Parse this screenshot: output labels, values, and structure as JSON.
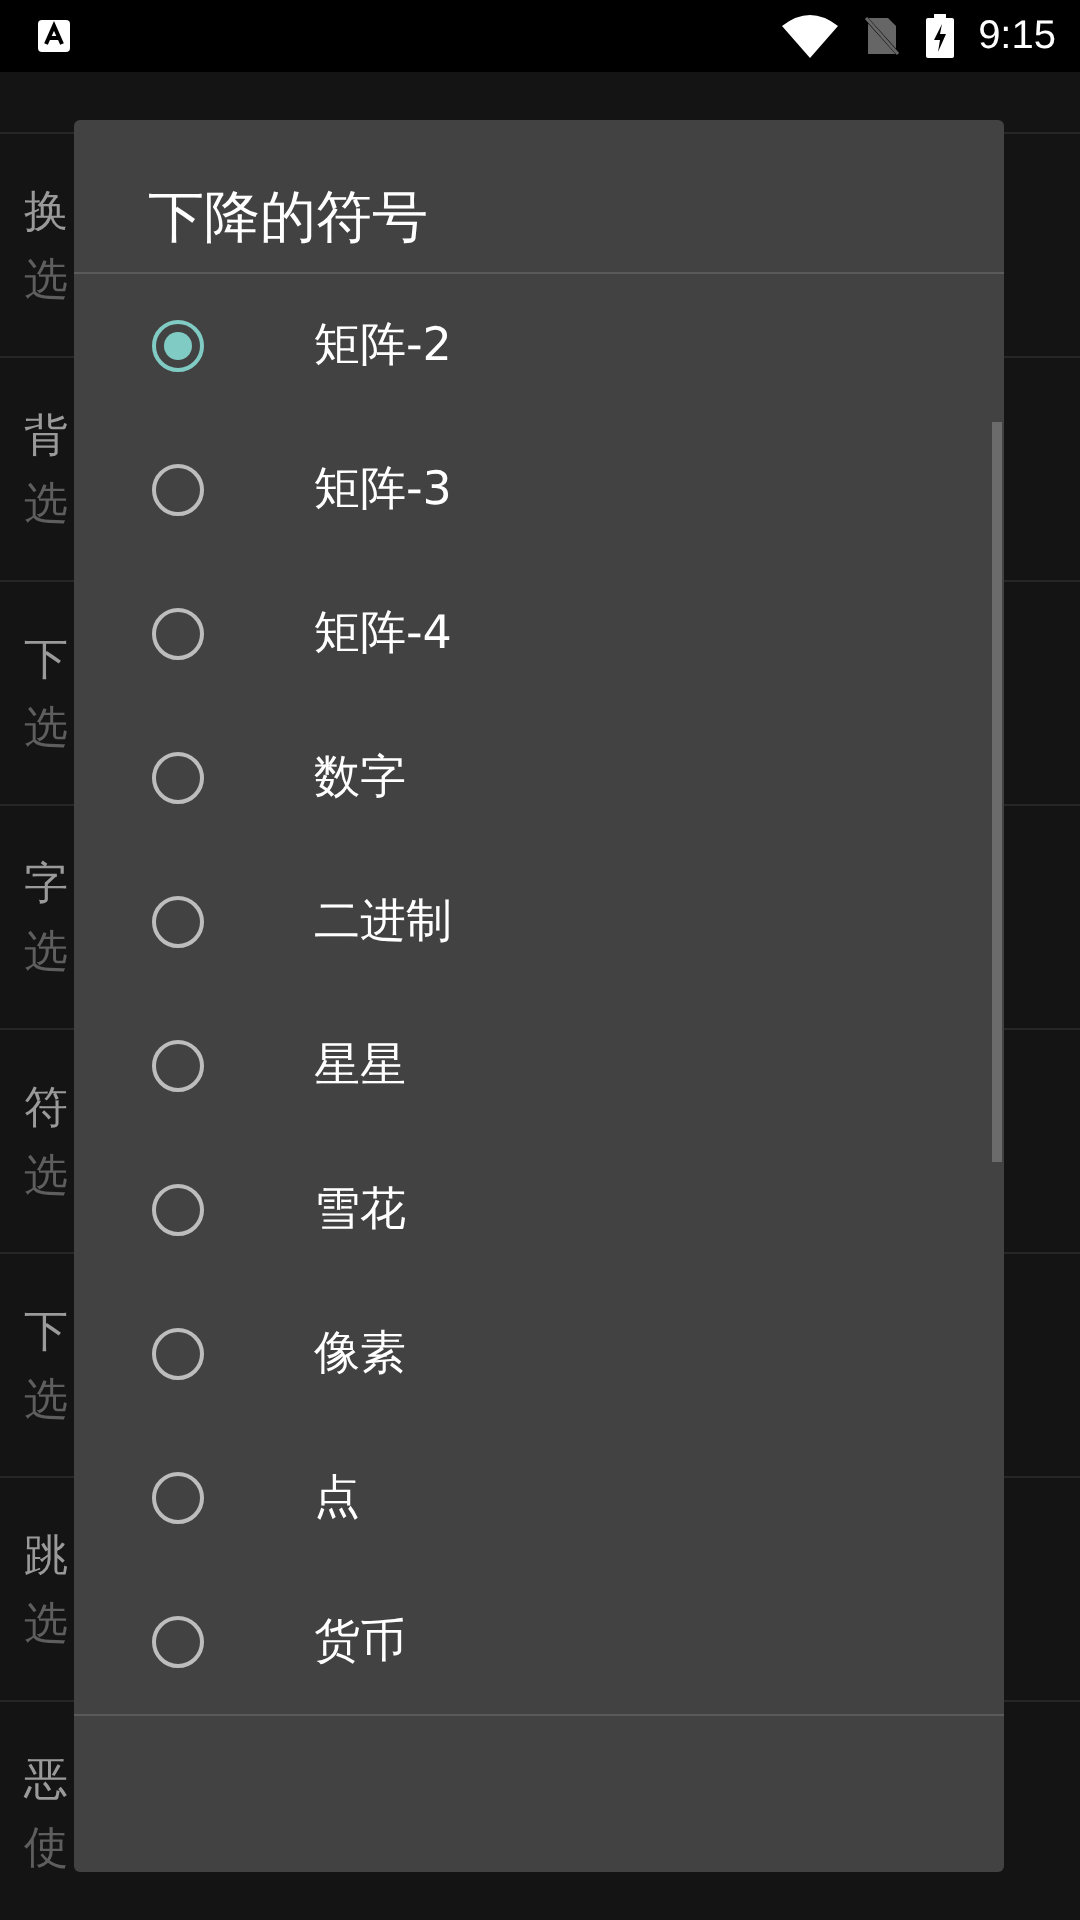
{
  "status_bar": {
    "time": "9:15"
  },
  "background_rows": [
    {
      "title": "换",
      "subtitle": "选"
    },
    {
      "title": "背",
      "subtitle": "选"
    },
    {
      "title": "下",
      "subtitle": "选"
    },
    {
      "title": "字",
      "subtitle": "选"
    },
    {
      "title": "符",
      "subtitle": "选"
    },
    {
      "title": "下",
      "subtitle": "选"
    },
    {
      "title": "跳",
      "subtitle": "选"
    },
    {
      "title": "恶",
      "subtitle": "使"
    }
  ],
  "dialog": {
    "title": "下降的符号",
    "options": [
      {
        "label": "矩阵-2",
        "selected": true
      },
      {
        "label": "矩阵-3",
        "selected": false
      },
      {
        "label": "矩阵-4",
        "selected": false
      },
      {
        "label": "数字",
        "selected": false
      },
      {
        "label": "二进制",
        "selected": false
      },
      {
        "label": "星星",
        "selected": false
      },
      {
        "label": "雪花",
        "selected": false
      },
      {
        "label": "像素",
        "selected": false
      },
      {
        "label": "点",
        "selected": false
      },
      {
        "label": "货币",
        "selected": false
      }
    ]
  }
}
